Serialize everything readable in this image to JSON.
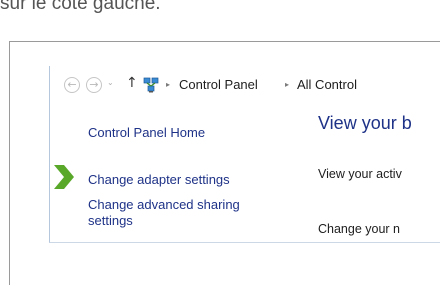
{
  "caption": "sur le côté gauche.",
  "nav": {
    "back_glyph": "←",
    "forward_glyph": "→",
    "dropdown_glyph": "⌵",
    "up_glyph": "↑",
    "location_icon": "network-icon"
  },
  "breadcrumb": {
    "separator": "▸",
    "items": [
      "Control Panel",
      "All Control"
    ]
  },
  "sidebar": {
    "home": "Control Panel Home",
    "items": [
      {
        "label": "Change adapter settings"
      },
      {
        "label_line1": "Change advanced sharing",
        "label_line2": "settings"
      }
    ]
  },
  "main": {
    "title": "View your b",
    "line1": "View your activ",
    "line2": "Change your n"
  },
  "colors": {
    "link": "#1e3287",
    "arrow": "#5aa82a"
  }
}
